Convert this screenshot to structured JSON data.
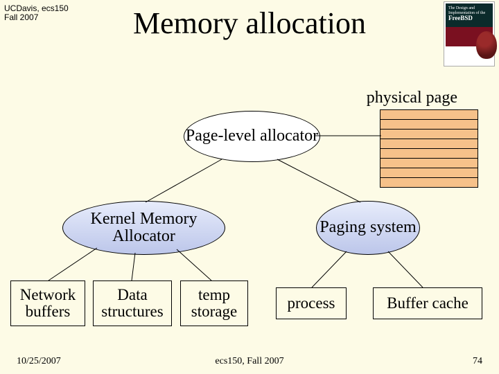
{
  "header": {
    "course": "UCDavis, ecs150",
    "term": "Fall 2007"
  },
  "title": "Memory allocation",
  "book": {
    "line1": "The Design and Implementation of the",
    "brand": "FreeBSD",
    "caption": ""
  },
  "labels": {
    "physical_page": "physical page"
  },
  "nodes": {
    "page_level_allocator": "Page-level allocator",
    "kernel_memory_allocator": "Kernel Memory Allocator",
    "paging_system": "Paging system"
  },
  "leaves": {
    "network_buffers": "Network buffers",
    "data_structures": "Data structures",
    "temp_storage": "temp storage",
    "process": "process",
    "buffer_cache": "Buffer cache"
  },
  "pages_box": {
    "rows": 8
  },
  "footer": {
    "date": "10/25/2007",
    "center": "ecs150, Fall 2007",
    "page": "74"
  }
}
